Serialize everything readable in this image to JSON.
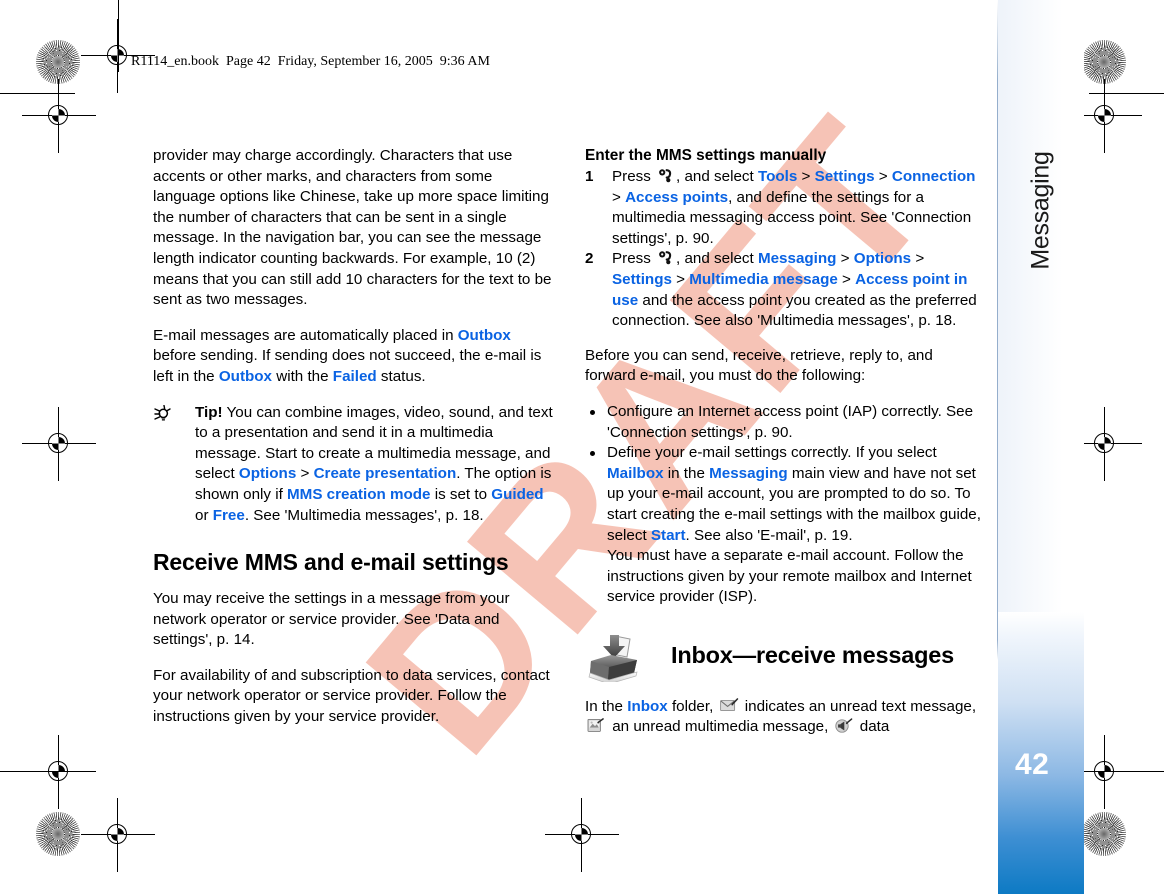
{
  "header": {
    "running_head": "R1114_en.book  Page 42  Friday, September 16, 2005  9:36 AM"
  },
  "watermark": {
    "text": "DRAFT",
    "color": "#f2a08a"
  },
  "sidebar": {
    "chapter_title": "Messaging",
    "page_number": "42",
    "accent_color": "#0d7ac4"
  },
  "link_color": "#0a63e3",
  "left_column": {
    "paragraph_1": {
      "text": "provider may charge accordingly. Characters that use accents or other marks, and characters from some language options like Chinese, take up more space limiting the number of characters that can be sent in a single message. In the navigation bar, you can see the message length indicator counting backwards. For example, 10 (2) means that you can still add 10 characters for the text to be sent as two messages."
    },
    "paragraph_2": {
      "part_1": "E-mail messages are automatically placed in ",
      "link_1": "Outbox",
      "part_2": " before sending. If sending does not succeed, the e-mail is left in the ",
      "link_2": "Outbox",
      "part_3": " with the ",
      "link_3": "Failed",
      "part_4": " status."
    },
    "tip": {
      "label": "Tip!",
      "part_1": " You can combine images, video, sound, and text to a presentation and send it in a multimedia message. Start to create a multimedia message, and select ",
      "link_1": "Options",
      "sep_1": " > ",
      "link_2": "Create presentation",
      "part_2": ". The option is shown only if ",
      "link_3": "MMS creation mode",
      "part_3": " is set to ",
      "link_4": "Guided",
      "part_4": " or ",
      "link_5": "Free",
      "part_5": ". See 'Multimedia messages', p. 18."
    },
    "heading": "Receive MMS and e-mail settings",
    "paragraph_3": "You may receive the settings in a message from your network operator or service provider. See 'Data and settings', p. 14.",
    "paragraph_4": "For availability of and subscription to data services, contact your network operator or service provider. Follow the instructions given by your service provider."
  },
  "right_column": {
    "subheading": "Enter the MMS settings manually",
    "steps": [
      {
        "number": "1",
        "part_1": "Press ",
        "icon": "menu-key-icon",
        "part_2": ", and select ",
        "link_1": "Tools",
        "sep_1": " > ",
        "link_2": "Settings",
        "sep_2": " > ",
        "link_3": "Connection",
        "sep_3": " > ",
        "link_4": "Access points",
        "part_3": ", and define the settings for a multimedia messaging access point. See 'Connection settings', p. 90."
      },
      {
        "number": "2",
        "part_1": "Press ",
        "icon": "menu-key-icon",
        "part_2": ", and select ",
        "link_1": "Messaging",
        "sep_1": " > ",
        "link_2": "Options",
        "sep_2": " > ",
        "link_3": "Settings",
        "sep_3": " > ",
        "link_4": "Multimedia message",
        "sep_4": " > ",
        "link_5": "Access point in use",
        "part_3": " and the access point you created as the preferred connection. See also 'Multimedia messages', p. 18."
      }
    ],
    "paragraph_1": "Before you can send, receive, retrieve, reply to, and forward e-mail, you must do the following:",
    "bullets": [
      {
        "text": "Configure an Internet access point (IAP) correctly. See 'Connection settings', p. 90."
      },
      {
        "part_1": "Define your e-mail settings correctly. If you select ",
        "link_1": "Mailbox",
        "part_2": " in the ",
        "link_2": "Messaging",
        "part_3": " main view and have not set up your e-mail account, you are prompted to do so. To start creating the e-mail settings with the mailbox guide, select ",
        "link_3": "Start",
        "part_4": ". See also 'E-mail', p. 19.",
        "part_5": "You must have a separate e-mail account. Follow the instructions given by your remote mailbox and Internet service provider (ISP)."
      }
    ],
    "inbox_heading": "Inbox—receive messages",
    "inbox_paragraph": {
      "part_1": "In the ",
      "link_1": "Inbox",
      "part_2": " folder, ",
      "icon_1": "unread-text-message-icon",
      "part_3": " indicates an unread text message, ",
      "icon_2": "unread-multimedia-message-icon",
      "part_4": " an unread multimedia message, ",
      "icon_3": "data-message-icon",
      "part_5": " data"
    }
  }
}
